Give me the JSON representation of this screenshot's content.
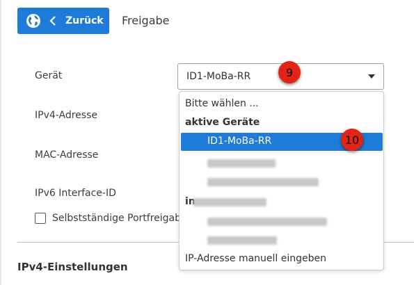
{
  "header": {
    "back_label": "Zurück",
    "breadcrumb": "Freigabe"
  },
  "form": {
    "device_label": "Gerät",
    "device_value": "ID1-MoBa-RR",
    "ipv4_label": "IPv4-Adresse",
    "mac_label": "MAC-Adresse",
    "ipv6_label": "IPv6 Interface-ID",
    "auto_port_label": "Selbstständige Portfreigab",
    "section_title": "IPv4-Einstellungen"
  },
  "dropdown": {
    "placeholder": "Bitte wählen ...",
    "group_active": "aktive Geräte",
    "selected": "ID1-MoBa-RR",
    "group_inactive_prefix": "in",
    "manual": "IP-Adresse manuell eingeben"
  },
  "annotations": {
    "badge_select": "9",
    "badge_option": "10"
  },
  "colors": {
    "accent": "#1e7bd8",
    "badge": "#e02418"
  },
  "icons": {
    "back_globe": "globe-icon",
    "back_chevron": "chevron-left-icon",
    "select_caret": "caret-down-icon"
  }
}
